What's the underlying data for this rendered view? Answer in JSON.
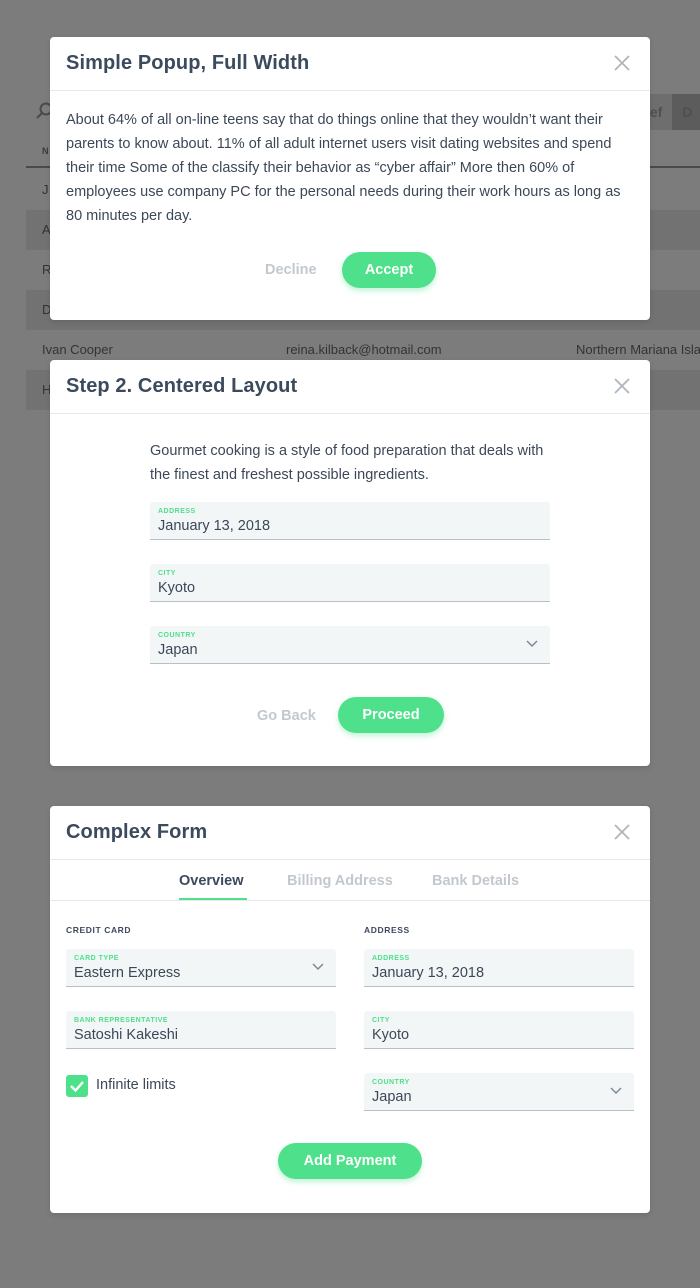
{
  "background": {
    "tab_buttons": [
      "ief",
      "D"
    ],
    "table_header": "N",
    "rows": [
      {
        "name": "J",
        "email": "",
        "country": ""
      },
      {
        "name": "A",
        "email": "",
        "country": ""
      },
      {
        "name": "R",
        "email": "",
        "country": ""
      },
      {
        "name": "D",
        "email": "",
        "country": ""
      },
      {
        "name": "Ivan Cooper",
        "email": "reina.kilback@hotmail.com",
        "country": "Northern Mariana Isla"
      },
      {
        "name": "H",
        "email": "",
        "country": ""
      }
    ]
  },
  "popup1": {
    "title": "Simple Popup, Full Width",
    "text": "About 64% of all on-line teens say that do things online that they wouldn’t want their parents to know about.   11% of all adult internet users visit dating websites and spend their time Some of the classify their behavior as “cyber affair”   More then 60% of employees use company PC for the personal needs during their work hours as long as 80 minutes per day.",
    "decline_label": "Decline",
    "accept_label": "Accept"
  },
  "popup2": {
    "title": "Step 2. Centered Layout",
    "text": "Gourmet cooking is a style of food preparation that deals with the finest and freshest possible ingredients.",
    "address_label": "ADDRESS",
    "address_value": "January 13, 2018",
    "city_label": "CITY",
    "city_value": "Kyoto",
    "country_label": "COUNTRY",
    "country_value": "Japan",
    "back_label": "Go Back",
    "proceed_label": "Proceed"
  },
  "popup3": {
    "title": "Complex Form",
    "tabs": [
      "Overview",
      "Billing Address",
      "Bank Details"
    ],
    "active_tab": "Overview",
    "credit_card_heading": "CREDIT CARD",
    "address_heading": "ADDRESS",
    "card_type_label": "CARD TYPE",
    "card_type_value": "Eastern Express",
    "bank_rep_label": "BANK REPRESENTATIVE",
    "bank_rep_value": "Satoshi Kakeshi",
    "checkbox_label": "Infinite limits",
    "checkbox_checked": true,
    "address_label": "ADDRESS",
    "address_value": "January 13, 2018",
    "city_label": "CITY",
    "city_value": "Kyoto",
    "country_label": "COUNTRY",
    "country_value": "Japan",
    "add_payment_label": "Add Payment"
  },
  "colors": {
    "accent": "#4ee08a",
    "overlay": "#7c7c7c",
    "title": "#3b4a5c",
    "muted": "#c2c8ce"
  }
}
